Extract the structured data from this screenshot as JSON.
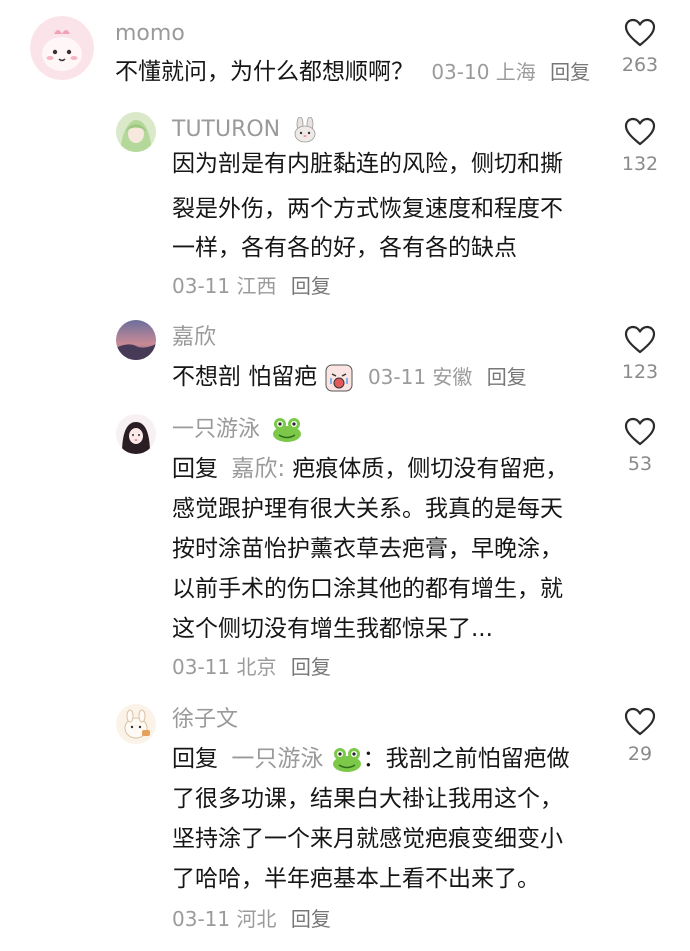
{
  "comments": [
    {
      "user": "momo",
      "lines": [
        "不懂就问，为什么都想顺啊？"
      ],
      "date": "03-10",
      "location": "上海",
      "reply_label": "回复",
      "likes": "263"
    },
    {
      "user": "TUTURON",
      "lines": [
        "因为剖是有内脏黏连的风险，侧切和撕",
        "裂是外伤，两个方式恢复速度和程度不",
        "一样，各有各的好，各有各的缺点"
      ],
      "date": "03-11",
      "location": "江西",
      "reply_label": "回复",
      "likes": "132"
    },
    {
      "user": "嘉欣",
      "lines": [
        "不想剖 怕留疤"
      ],
      "date": "03-11",
      "location": "安徽",
      "reply_label": "回复",
      "likes": "123"
    },
    {
      "user": "一只游泳",
      "reply_prefix": "回复",
      "reply_to": "嘉欣:",
      "lines": [
        " 疤痕体质，侧切没有留疤，",
        "感觉跟护理有很大关系。我真的是每天",
        "按时涂苗怡护薰衣草去疤膏，早晚涂，",
        "以前手术的伤口涂其他的都有增生，就",
        "这个侧切没有增生我都惊呆了..."
      ],
      "date": "03-11",
      "location": "北京",
      "reply_label": "回复",
      "likes": "53"
    },
    {
      "user": "徐子文",
      "reply_prefix": "回复",
      "reply_to": "一只游泳",
      "lines": [
        "：我剖之前怕留疤做",
        "了很多功课，结果白大褂让我用这个，",
        "坚持涂了一个来月就感觉疤痕变细变小",
        "了哈哈，半年疤基本上看不出来了。"
      ],
      "date": "03-11",
      "location": "河北",
      "reply_label": "回复",
      "likes": "29"
    }
  ]
}
